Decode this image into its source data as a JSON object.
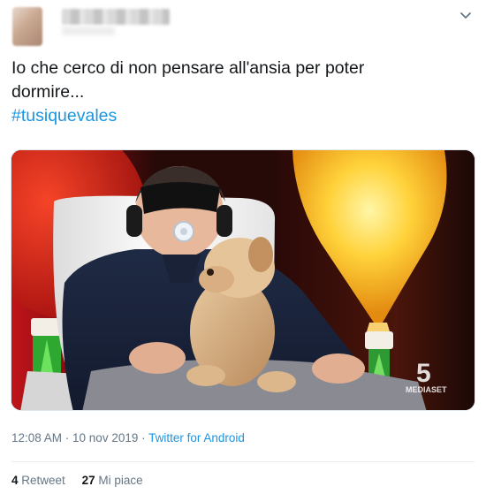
{
  "tweet": {
    "text_line1": "Io che cerco di non pensare all'ansia per poter",
    "text_line2": "dormire...",
    "hashtag": "#tusiquevales",
    "timestamp": "12:08 AM · 10 nov 2019 · ",
    "source": "Twitter for Android",
    "retweet_count": "4",
    "retweet_label": "Retweet",
    "like_count": "27",
    "like_label": "Mi piace"
  },
  "media": {
    "watermark_number": "5",
    "watermark_text": "MEDIASET"
  },
  "icons": {
    "menu": "chevron-down-icon"
  },
  "colors": {
    "link": "#1b95e0",
    "muted": "#657786",
    "text": "#14171a"
  }
}
